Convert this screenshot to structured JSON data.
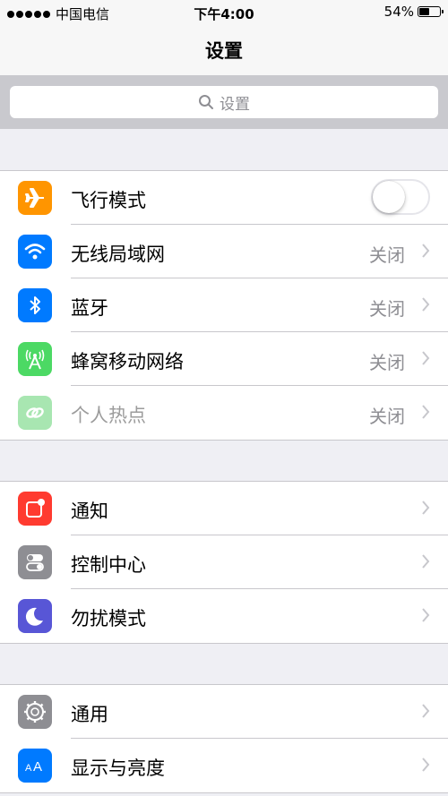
{
  "status_bar": {
    "carrier": "中国电信",
    "time": "下午4:00",
    "battery": "54%",
    "battery_level": 0.54
  },
  "nav": {
    "title": "设置"
  },
  "search": {
    "placeholder": "设置"
  },
  "groups": [
    {
      "items": [
        {
          "label": "飞行模式",
          "icon": "airplane-icon",
          "color": "#ff9500",
          "control": "toggle",
          "toggle_on": false
        },
        {
          "label": "无线局域网",
          "icon": "wifi-icon",
          "color": "#007aff",
          "value": "关闭"
        },
        {
          "label": "蓝牙",
          "icon": "bluetooth-icon",
          "color": "#007aff",
          "value": "关闭"
        },
        {
          "label": "蜂窝移动网络",
          "icon": "cellular-icon",
          "color": "#4cd964",
          "value": "关闭"
        },
        {
          "label": "个人热点",
          "icon": "hotspot-icon",
          "color": "#a8e6b1",
          "value": "关闭",
          "disabled": true
        }
      ]
    },
    {
      "items": [
        {
          "label": "通知",
          "icon": "notifications-icon",
          "color": "#ff3b30"
        },
        {
          "label": "控制中心",
          "icon": "control-center-icon",
          "color": "#8e8e93"
        },
        {
          "label": "勿扰模式",
          "icon": "moon-icon",
          "color": "#5856d6"
        }
      ]
    },
    {
      "items": [
        {
          "label": "通用",
          "icon": "gear-icon",
          "color": "#8e8e93"
        },
        {
          "label": "显示与亮度",
          "icon": "display-brightness-icon",
          "color": "#007aff"
        }
      ]
    }
  ]
}
